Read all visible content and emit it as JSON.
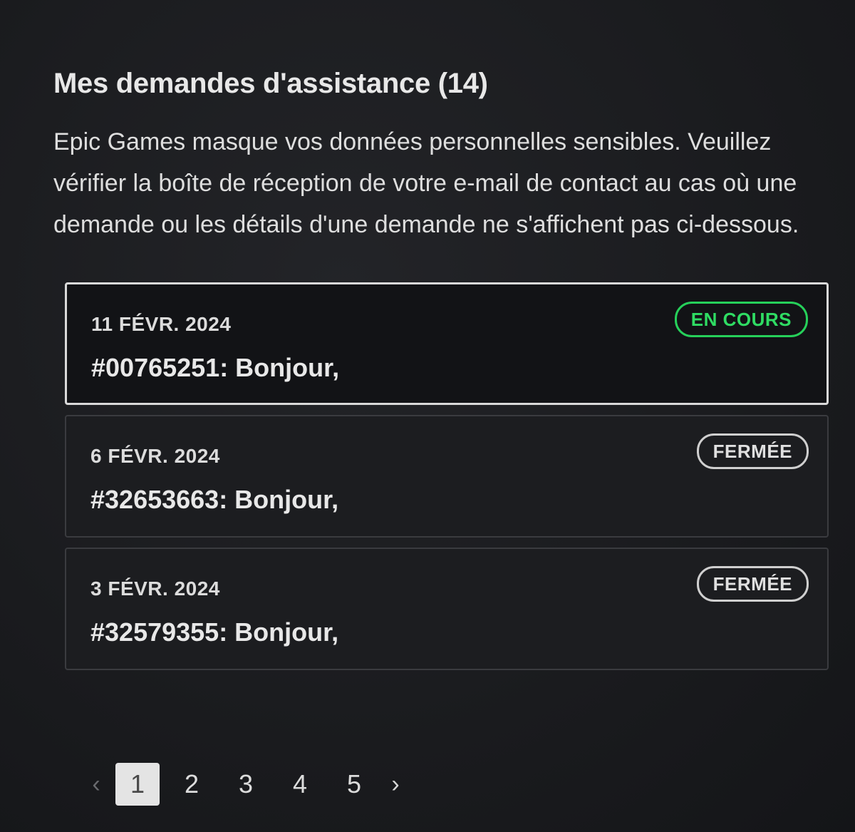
{
  "header": {
    "title": "Mes demandes d'assistance (14)",
    "description": "Epic Games masque vos données personnelles sensibles. Veuillez vérifier la boîte de réception de votre e-mail de contact au cas où une demande ou les détails d'une demande ne s'affichent pas ci-dessous."
  },
  "tickets": [
    {
      "date": "11 FÉVR. 2024",
      "subject": "#00765251: Bonjour,",
      "status": "EN COURS",
      "status_color": "#2fdc63",
      "selected": true
    },
    {
      "date": "6 FÉVR. 2024",
      "subject": "#32653663: Bonjour,",
      "status": "FERMÉE",
      "status_color": "#e0e0e0",
      "selected": false
    },
    {
      "date": "3 FÉVR. 2024",
      "subject": "#32579355: Bonjour,",
      "status": "FERMÉE",
      "status_color": "#e0e0e0",
      "selected": false
    }
  ],
  "pagination": {
    "prev_icon": "chevron-left-icon",
    "next_icon": "chevron-right-icon",
    "pages": [
      "1",
      "2",
      "3",
      "4",
      "5"
    ],
    "current_page": "1"
  }
}
